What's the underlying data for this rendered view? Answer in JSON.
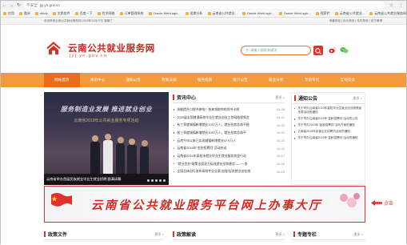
{
  "browser": {
    "security_label": "不安全",
    "url": "jyj.yn.gov.cn",
    "bookmarks": [
      "应用",
      "酷米",
      "study",
      "文思软件",
      "百度一下",
      "优学网络",
      "订单管理系统",
      "Oracle WebLogic...",
      "坐席分析",
      "云南省公共就业...",
      "Oracle WebLogic...",
      "Oracle WebLogic...",
      "搜索栏",
      "云南省公共就业...",
      "云南省公共就业服务网"
    ]
  },
  "topbar": {
    "welcome": "欢迎来到云南公共就业服务网   2019年11月27日 星期三",
    "links": "收藏网站 | 设为首页 | 站内导航 | 官方微博"
  },
  "header": {
    "site_name": "云南公共就业服务网",
    "site_domain": "jyj.yn.gov.cn",
    "search_placeholder": "请输入搜索关键字"
  },
  "nav": {
    "items": [
      "网站首页",
      "资讯中心",
      "通知公告",
      "政策法规",
      "服务指南",
      "统计公告",
      "就业分析",
      "专题专栏",
      "互动交流"
    ],
    "active_index": 0
  },
  "banner": {
    "slogan": "服务制造业发展 推进就业创业",
    "subtitle": "云南省2019年公共就业服务专项活动",
    "caption": "云南省举办首届民族就业毕业生就业招聘  圆满闭幕"
  },
  "news": {
    "title": "资讯中心",
    "more": "更多 >",
    "items": [
      {
        "title": "技能提升口袋书来啦！快来领取你的领书卡吧",
        "date": "11-26"
      },
      {
        "title": "2020届全国普通高校毕业生就业创业工作网络视频会",
        "date": "11-21"
      },
      {
        "title": "有三季度城镇新增就业1097万人，就业形势总体平稳",
        "date": "10-23"
      },
      {
        "title": "前三季度城镇新增就业1097万人，就业形势总体平",
        "date": "10-21"
      },
      {
        "title": "云南今年以来已实现城镇新增就业47.9万人",
        "date": "10-21"
      },
      {
        "title": "云南省2019年“金秋招聘月”活动启动",
        "date": "10-21"
      },
      {
        "title": "云南省2019年高校未就业毕业生就业服务攻坚行动",
        "date": "10-17"
      },
      {
        "title": "“就业优先”政策全面发力促进就业形势稳定——一季",
        "date": "10-16"
      },
      {
        "title": "全国总体自行发布高校专业业表 加强“促进就业创业统",
        "date": "10-15"
      }
    ]
  },
  "notice": {
    "title": "通知公告",
    "more": "更多 >",
    "items": [
      "关于举办云南省2019年高校毕业生就业创业政策宣传周活动的通知",
      "关于举办云南省2019年“金秋招聘月”活动的公告",
      "关于举办2019年“金秋招聘月”活动方案的通知",
      "云南省2019年民营企业招聘月活动的通知",
      "关于举办云南省2019年“金秋招聘月”活动的通知"
    ]
  },
  "ad": {
    "text": "云南省公共就业服务平台网上办事大厅",
    "annotation": "点击"
  },
  "bottom": {
    "policy_title": "政策文件",
    "policy_more": "更多 >",
    "interpret_title": "政策解读",
    "interpret_more": "更多 >",
    "topics_title": "专题专栏",
    "topics_more": "更多 >"
  }
}
